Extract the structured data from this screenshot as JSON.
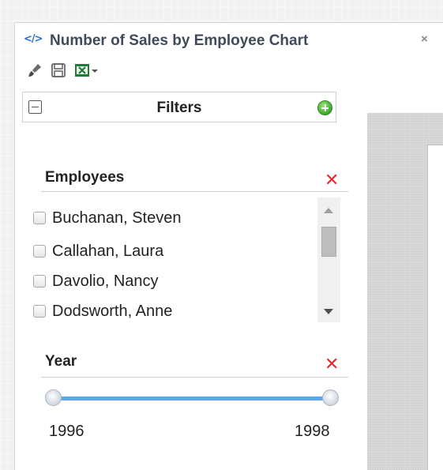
{
  "window": {
    "title": "Number of Sales by Employee Chart",
    "title_icon": "code-icon",
    "close_label": "×"
  },
  "toolbar": {
    "icons": [
      "brush-icon",
      "save-icon",
      "excel-export-icon",
      "dropdown-arrow-icon"
    ]
  },
  "filters": {
    "label": "Filters",
    "collapse_icon": "collapse-icon",
    "add_icon": "add-icon"
  },
  "employees": {
    "title": "Employees",
    "clear_label": "✕",
    "items": [
      {
        "label": "Buchanan, Steven",
        "checked": false
      },
      {
        "label": "Callahan, Laura",
        "checked": false
      },
      {
        "label": "Davolio, Nancy",
        "checked": false
      },
      {
        "label": "Dodsworth, Anne",
        "checked": false
      }
    ]
  },
  "year": {
    "title": "Year",
    "clear_label": "✕",
    "min_label": "1996",
    "max_label": "1998",
    "range": [
      1996,
      1998
    ]
  },
  "colors": {
    "accent": "#5aa7f0",
    "clear": "#e52b2b",
    "add": "#3ea72b",
    "title_text": "#3f4a5a"
  }
}
